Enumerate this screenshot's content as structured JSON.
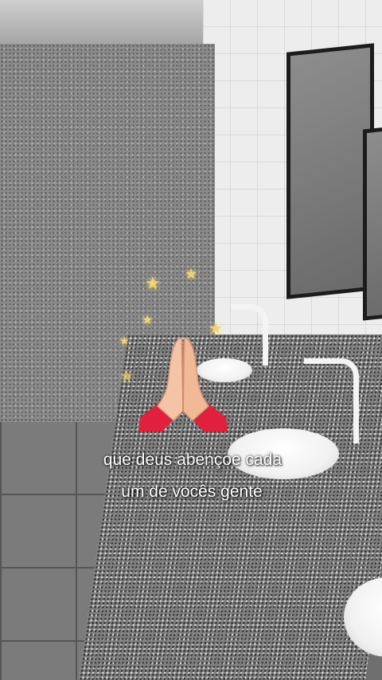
{
  "caption": {
    "line1": "que deus abençoe cada",
    "line2": "um de vocês gente"
  },
  "sticker": {
    "emoji": "folded-hands-icon",
    "sparkle_glyph": "★",
    "sparkle_color": "#f5d36b"
  },
  "scene": {
    "setting": "restroom-sinks-granite-counter"
  }
}
